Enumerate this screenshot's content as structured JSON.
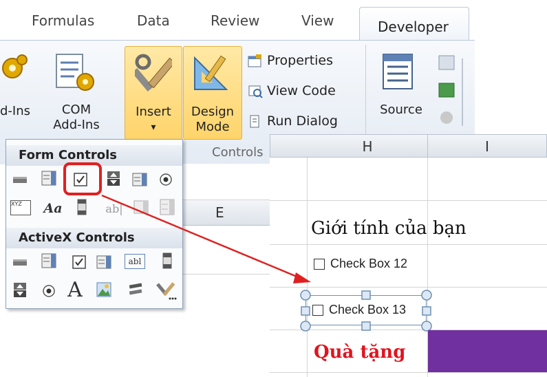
{
  "tabs": [
    {
      "label": "Formulas"
    },
    {
      "label": "Data"
    },
    {
      "label": "Review"
    },
    {
      "label": "View"
    },
    {
      "label": "Developer"
    }
  ],
  "ribbon": {
    "addins_label": "d-Ins",
    "com_line1": "COM",
    "com_line2": "Add-Ins",
    "insert_label": "Insert",
    "insert_arrow": "▾",
    "design_line1": "Design",
    "design_line2": "Mode",
    "properties_label": "Properties",
    "viewcode_label": "View Code",
    "rundialog_label": "Run Dialog",
    "source_label": "Source",
    "controls_group": "Controls"
  },
  "popup": {
    "form_controls_header": "Form Controls",
    "activex_header": "ActiveX Controls",
    "form_icons": [
      "button-icon",
      "combo-box-icon",
      "checkbox-icon",
      "spin-button-icon",
      "list-box-icon",
      "option-button-icon",
      "group-box-icon",
      "label-icon",
      "scroll-bar-icon",
      "text-field-icon",
      "combo-list-edit-icon",
      "combo-drop-down-edit-icon"
    ],
    "activex_icons": [
      "command-button-icon",
      "combo-box-icon",
      "checkbox-icon",
      "list-box-icon",
      "text-box-icon",
      "scroll-bar-icon",
      "spin-button-icon",
      "option-button-icon",
      "label-icon",
      "image-icon",
      "toggle-button-icon",
      "more-controls-icon"
    ],
    "glyph_aa": "Aa",
    "glyph_ab": "ab|",
    "glyph_abl": "abl",
    "glyph_a": "A",
    "glyph_xyz": "XYZ"
  },
  "sheet": {
    "col_e": "E",
    "col_h": "H",
    "col_i": "I",
    "gender_title": "Giới tính của bạn",
    "checkbox12": "Check Box 12",
    "checkbox13": "Check Box 13",
    "gift_title": "Quà tặng"
  },
  "colors": {
    "highlight_red": "#e02020",
    "purple_cell": "#7030a0",
    "gift_red": "#e0141e",
    "ribbon_highlight": "#ffd46a"
  }
}
